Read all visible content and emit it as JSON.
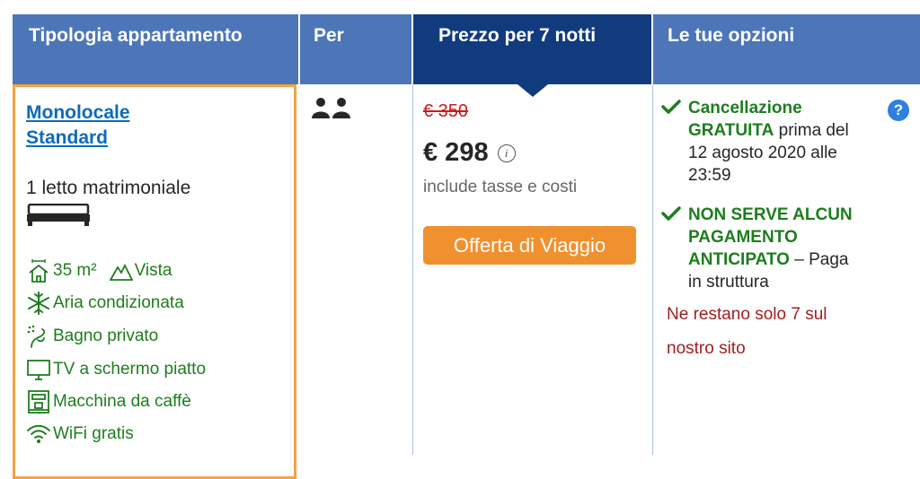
{
  "header": {
    "col_type": "Tipologia appartamento",
    "col_per": "Per",
    "col_price": "Prezzo per 7 notti",
    "col_options": "Le tue opzioni"
  },
  "room": {
    "title_line1": "Monolocale",
    "title_line2": "Standard",
    "bed": "1 letto matrimoniale",
    "bed_icon": "double-bed-icon",
    "facilities": [
      {
        "icon": "room-size-icon",
        "label": "35 m²"
      },
      {
        "icon": "mountain-view-icon",
        "label": "Vista"
      },
      {
        "icon": "snowflake-icon",
        "label": "Aria condizionata"
      },
      {
        "icon": "shower-icon",
        "label": "Bagno privato"
      },
      {
        "icon": "tv-icon",
        "label": "TV a schermo piatto"
      },
      {
        "icon": "coffee-machine-icon",
        "label": "Macchina da caffè"
      },
      {
        "icon": "wifi-icon",
        "label": "WiFi gratis"
      }
    ]
  },
  "occupancy": {
    "icon": "two-persons-icon"
  },
  "price": {
    "old": "€ 350",
    "current": "€ 298",
    "info": "i",
    "taxes": "include tasse e costi",
    "deal_badge": "Offerta di Viaggio"
  },
  "options": {
    "cancel_bold_1": "Cancellazione",
    "cancel_bold_2": "GRATUITA",
    "cancel_rest_1": " prima del",
    "cancel_rest_2": "12 agosto 2020 alle",
    "cancel_rest_3": "23:59",
    "prepay_bold_1": "NON SERVE ALCUN",
    "prepay_bold_2": "PAGAMENTO",
    "prepay_bold_3": "ANTICIPATO",
    "prepay_rest_1": " – Paga",
    "prepay_rest_2": "in struttura",
    "urgency_1": "Ne restano solo 7 sul",
    "urgency_2": "nostro sito",
    "help": "?"
  },
  "colors": {
    "header_blue": "#4d76b8",
    "header_dark": "#123b7e",
    "highlight_orange": "#f4a342",
    "green": "#1e7d1e",
    "red": "#cc1b1b"
  }
}
